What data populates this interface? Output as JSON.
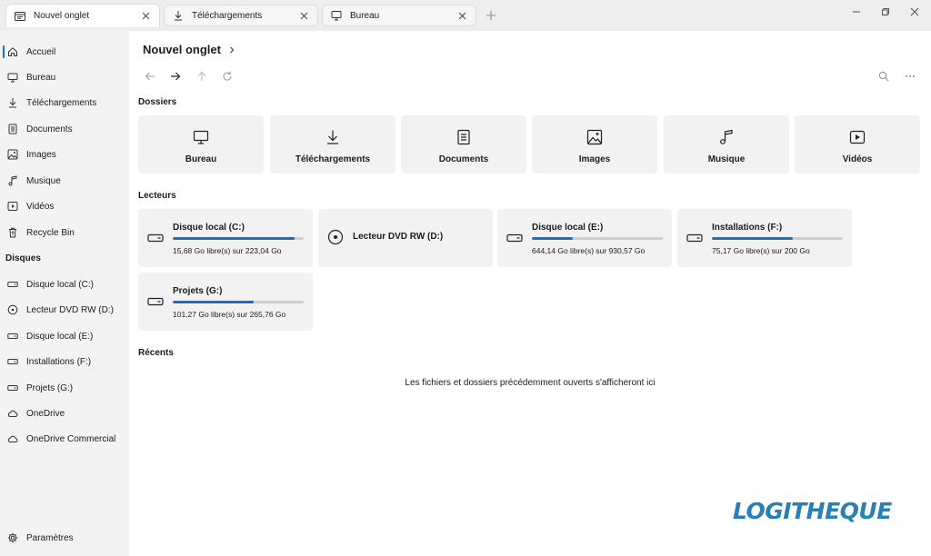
{
  "tabs": [
    {
      "label": "Nouvel onglet",
      "icon": "file-explorer-icon",
      "active": true
    },
    {
      "label": "Téléchargements",
      "icon": "download-icon",
      "active": false
    },
    {
      "label": "Bureau",
      "icon": "desktop-icon",
      "active": false
    }
  ],
  "sidebar": {
    "items": [
      {
        "label": "Accueil",
        "icon": "home-icon",
        "selected": true
      },
      {
        "label": "Bureau",
        "icon": "desktop-icon"
      },
      {
        "label": "Téléchargements",
        "icon": "download-icon"
      },
      {
        "label": "Documents",
        "icon": "document-icon"
      },
      {
        "label": "Images",
        "icon": "image-icon"
      },
      {
        "label": "Musique",
        "icon": "music-icon"
      },
      {
        "label": "Vidéos",
        "icon": "video-icon"
      },
      {
        "label": "Recycle Bin",
        "icon": "recycle-bin-icon"
      }
    ],
    "disks_header": "Disques",
    "disks": [
      {
        "label": "Disque local (C:)",
        "icon": "drive-icon"
      },
      {
        "label": "Lecteur DVD RW (D:)",
        "icon": "dvd-icon"
      },
      {
        "label": "Disque local (E:)",
        "icon": "drive-icon"
      },
      {
        "label": "Installations (F:)",
        "icon": "drive-icon"
      },
      {
        "label": "Projets (G:)",
        "icon": "drive-icon"
      },
      {
        "label": "OneDrive",
        "icon": "cloud-icon"
      },
      {
        "label": "OneDrive Commercial",
        "icon": "cloud-icon"
      }
    ],
    "settings_label": "Paramètres"
  },
  "main": {
    "breadcrumb": "Nouvel onglet",
    "folders_title": "Dossiers",
    "folders": [
      {
        "label": "Bureau",
        "icon": "desktop-icon"
      },
      {
        "label": "Téléchargements",
        "icon": "download-icon"
      },
      {
        "label": "Documents",
        "icon": "document-icon"
      },
      {
        "label": "Images",
        "icon": "image-icon"
      },
      {
        "label": "Musique",
        "icon": "music-icon"
      },
      {
        "label": "Vidéos",
        "icon": "video-icon"
      }
    ],
    "drives_title": "Lecteurs",
    "drives": [
      {
        "name": "Disque local (C:)",
        "space": "15,68 Go libre(s) sur 223,04 Go",
        "used_fraction": 0.93
      },
      {
        "name": "Lecteur DVD RW (D:)",
        "space": "",
        "used_fraction": null
      },
      {
        "name": "Disque local (E:)",
        "space": "644,14 Go libre(s) sur 930,57 Go",
        "used_fraction": 0.31
      },
      {
        "name": "Installations (F:)",
        "space": "75,17 Go libre(s) sur 200 Go",
        "used_fraction": 0.62
      },
      {
        "name": "Projets (G:)",
        "space": "101,27 Go libre(s) sur 265,76 Go",
        "used_fraction": 0.62
      }
    ],
    "recent_title": "Récents",
    "recent_empty": "Les fichiers et dossiers précédemment ouverts s'afficheront ici"
  },
  "watermark": "LOGITHEQUE",
  "colors": {
    "accent": "#1b6ec2",
    "card_bg": "#f2f2f2",
    "sidebar_bg": "#f3f3f3",
    "watermark": "#2a7fb4"
  }
}
